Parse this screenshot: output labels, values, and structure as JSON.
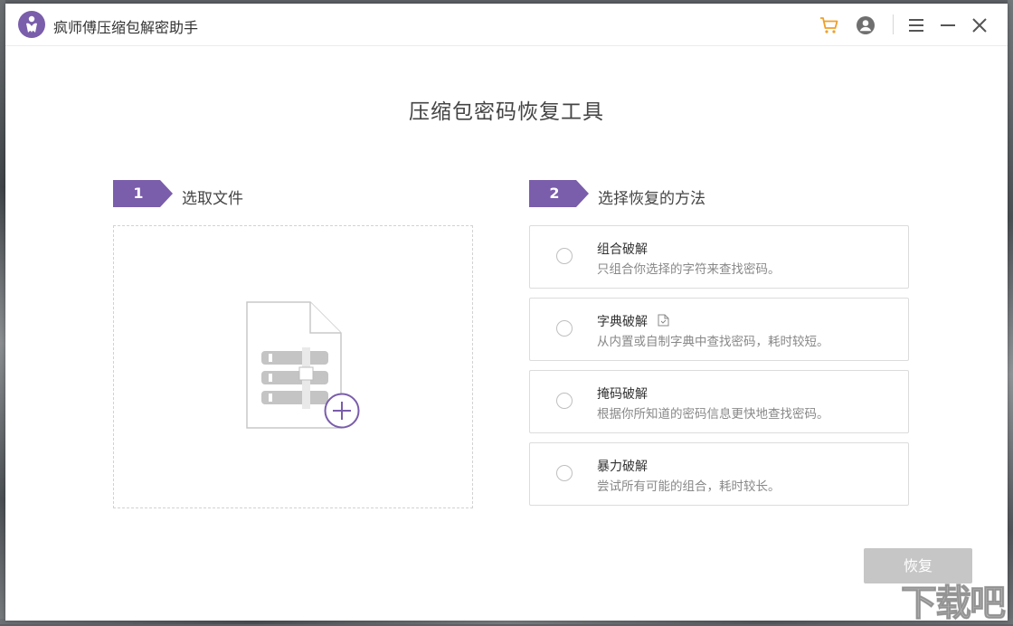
{
  "app": {
    "title": "疯师傅压缩包解密助手",
    "accent_color": "#7a5dab",
    "cart_color": "#f0a028"
  },
  "titlebar": {
    "icons": [
      "cart-icon",
      "user-account-icon",
      "menu-icon",
      "minimize-icon",
      "close-icon"
    ]
  },
  "main": {
    "page_title": "压缩包密码恢复工具",
    "step1": {
      "number": "1",
      "label": "选取文件"
    },
    "step2": {
      "number": "2",
      "label": "选择恢复的方法"
    },
    "dropzone_icon": "archive-file-add-icon",
    "options": [
      {
        "title": "组合破解",
        "desc": "只组合你选择的字符来查找密码。",
        "selected": false
      },
      {
        "title": "字典破解",
        "desc": "从内置或自制字典中查找密码，耗时较短。",
        "selected": false,
        "extra_icon": "dictionary-file-icon"
      },
      {
        "title": "掩码破解",
        "desc": "根据你所知道的密码信息更快地查找密码。",
        "selected": false
      },
      {
        "title": "暴力破解",
        "desc": "尝试所有可能的组合，耗时较长。",
        "selected": false
      }
    ],
    "restore_button": "恢复"
  },
  "watermark": "下载吧"
}
